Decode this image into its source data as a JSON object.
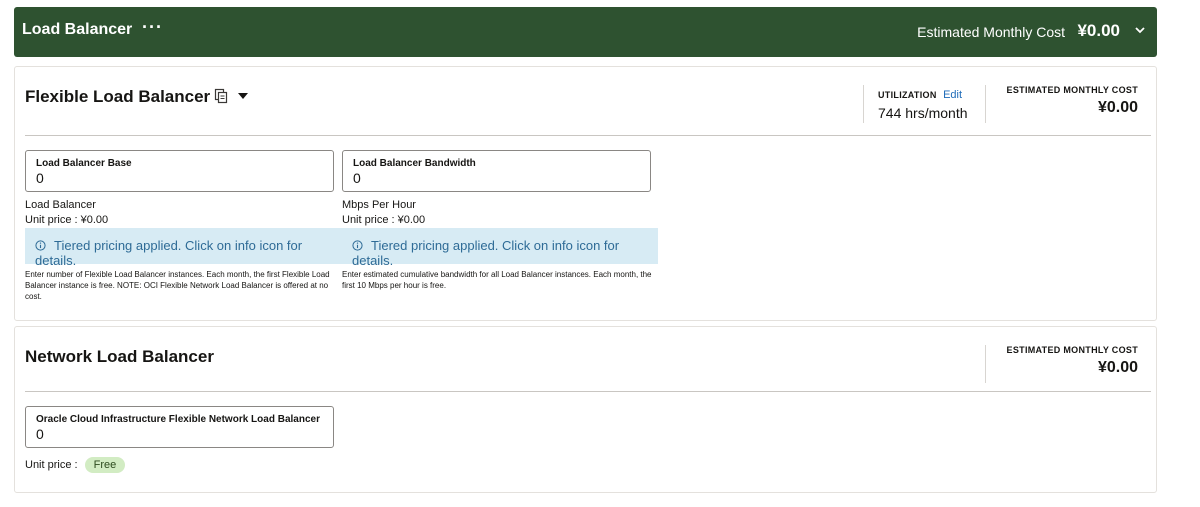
{
  "header": {
    "title": "Load Balancer",
    "more_label": "···",
    "cost_label": "Estimated Monthly Cost",
    "cost_value": "¥0.00",
    "chevron_icon": "chevron-down-icon",
    "bg_color": "#2e5230"
  },
  "flexible": {
    "title": "Flexible Load Balancer",
    "copy_icon": "copy-icon",
    "caret_icon": "caret-down-icon",
    "utilization": {
      "label": "UTILIZATION",
      "edit_label": "Edit",
      "value": "744 hrs/month"
    },
    "cost": {
      "label": "ESTIMATED MONTHLY COST",
      "value": "¥0.00"
    },
    "fields": [
      {
        "label": "Load Balancer Base",
        "value": "0",
        "unit_name": "Load Balancer",
        "unit_price_label": "Unit price :",
        "unit_price": "¥0.00",
        "tier_text": "Tiered pricing applied. Click on info icon for details.",
        "note": "Enter number of Flexible Load Balancer instances. Each month, the first Flexible Load Balancer instance is free. NOTE: OCI Flexible Network Load Balancer is offered at no cost."
      },
      {
        "label": "Load Balancer Bandwidth",
        "value": "0",
        "unit_name": "Mbps Per Hour",
        "unit_price_label": "Unit price :",
        "unit_price": "¥0.00",
        "tier_text": "Tiered pricing applied. Click on info icon for details.",
        "note": "Enter estimated cumulative bandwidth for all Load Balancer instances. Each month, the first 10 Mbps per hour is free."
      }
    ],
    "tier_color": "#d7ebf4"
  },
  "network": {
    "title": "Network Load Balancer",
    "cost": {
      "label": "ESTIMATED MONTHLY COST",
      "value": "¥0.00"
    },
    "field": {
      "label": "Oracle Cloud Infrastructure Flexible Network Load Balancer",
      "value": "0"
    },
    "unit_price_label": "Unit price :",
    "unit_price": "Free",
    "badge_color": "#d2ecc3"
  }
}
